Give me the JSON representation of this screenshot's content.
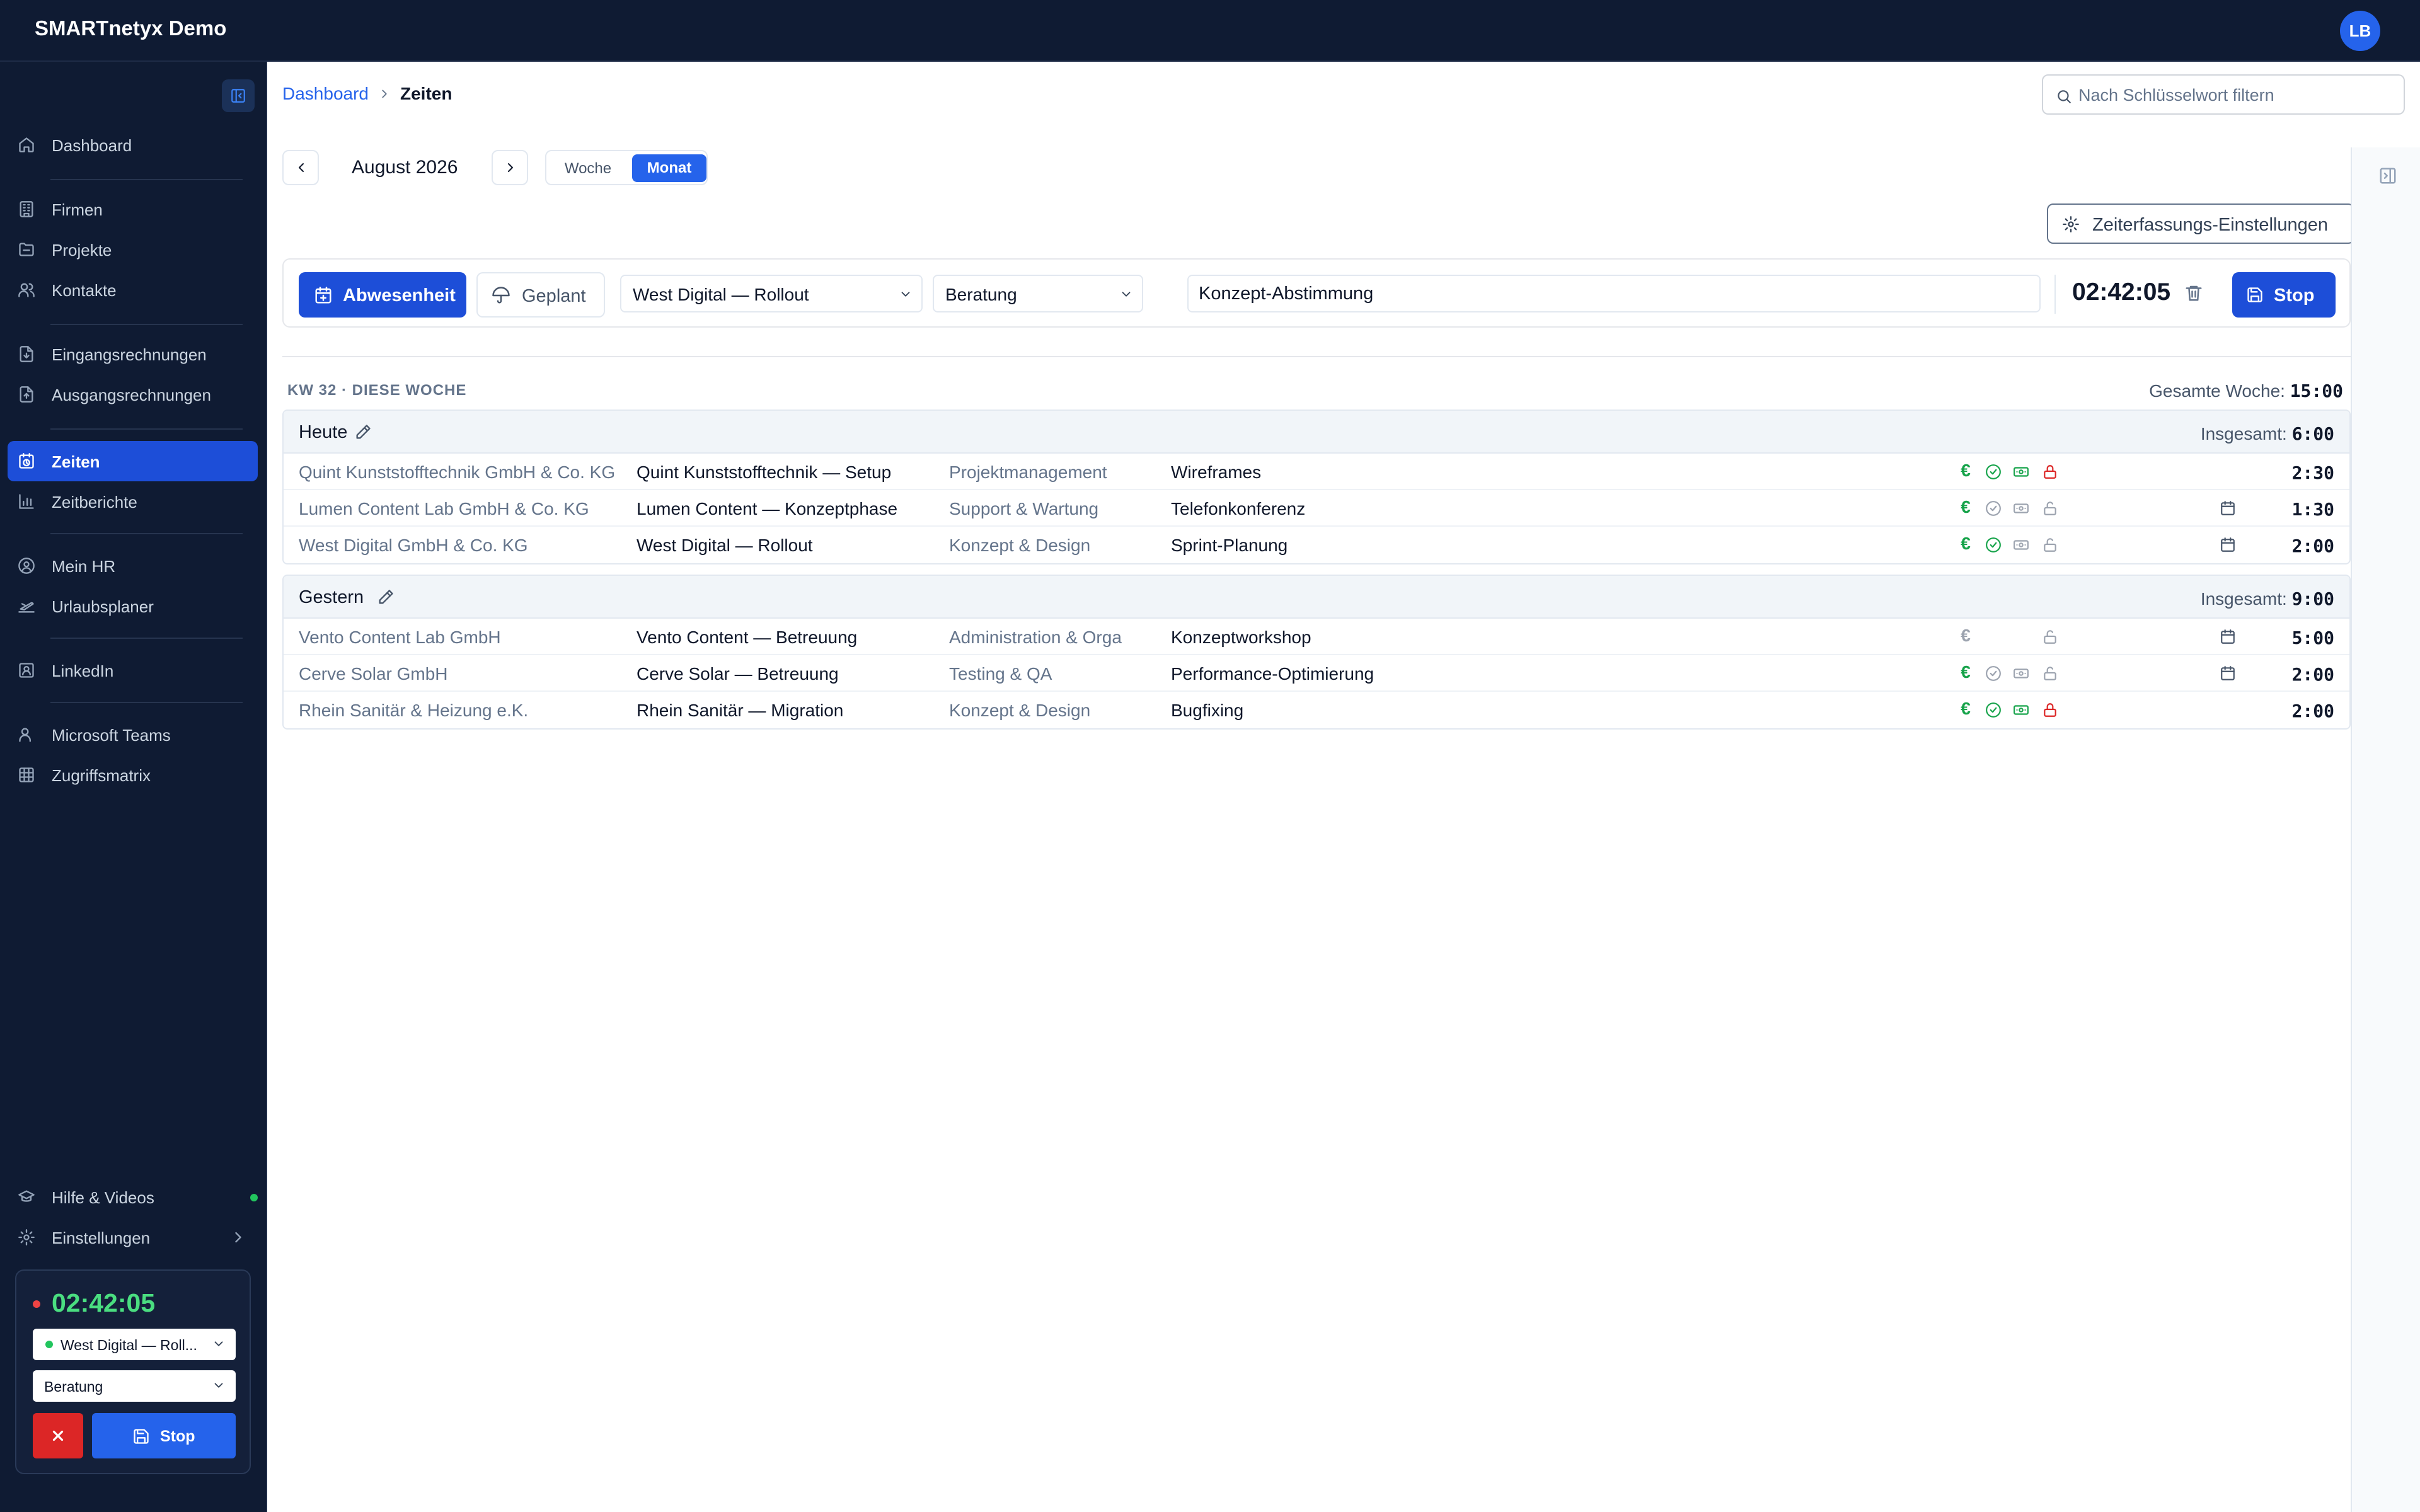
{
  "app": {
    "title": "SMARTnetyx Demo",
    "user_initials": "LB"
  },
  "sidebar": {
    "items": [
      {
        "label": "Dashboard",
        "icon": "home-icon",
        "active": false
      },
      {
        "label": "Firmen",
        "icon": "building-icon",
        "active": false
      },
      {
        "label": "Projekte",
        "icon": "folder-icon",
        "active": false
      },
      {
        "label": "Kontakte",
        "icon": "users-icon",
        "active": false
      },
      {
        "label": "Eingangsrechnungen",
        "icon": "invoice-in-icon",
        "active": false
      },
      {
        "label": "Ausgangsrechnungen",
        "icon": "invoice-out-icon",
        "active": false
      },
      {
        "label": "Zeiten",
        "icon": "clock-icon",
        "active": true
      },
      {
        "label": "Zeitberichte",
        "icon": "chart-icon",
        "active": false
      },
      {
        "label": "Mein HR",
        "icon": "user-circle-icon",
        "active": false
      },
      {
        "label": "Urlaubsplaner",
        "icon": "plane-icon",
        "active": false
      },
      {
        "label": "LinkedIn",
        "icon": "linkedin-icon",
        "active": false
      },
      {
        "label": "Microsoft Teams",
        "icon": "teams-icon",
        "active": false
      },
      {
        "label": "Zugriffsmatrix",
        "icon": "grid-icon",
        "active": false
      }
    ],
    "bottom": {
      "help_label": "Hilfe & Videos",
      "settings_label": "Einstellungen"
    },
    "timer": {
      "time": "02:42:05",
      "project": "West Digital — Roll...",
      "activity": "Beratung",
      "stop_label": "Stop"
    }
  },
  "breadcrumb": {
    "home": "Dashboard",
    "current": "Zeiten"
  },
  "search": {
    "placeholder": "Nach Schlüsselwort filtern"
  },
  "calendar": {
    "period": "August 2026",
    "view_week": "Woche",
    "view_month": "Monat",
    "active_view": "Monat"
  },
  "settings_button": "Zeiterfassungs-Einstellungen",
  "tracker": {
    "absence_label": "Abwesenheit",
    "planned_label": "Geplant",
    "project": "West Digital — Rollout",
    "activity": "Beratung",
    "description": "Konzept-Abstimmung",
    "elapsed": "02:42:05",
    "stop_label": "Stop"
  },
  "week": {
    "label": "KW 32 · DIESE WOCHE",
    "total_label": "Gesamte Woche:",
    "total": "15:00"
  },
  "days": [
    {
      "title": "Heute",
      "total_label": "Insgesamt:",
      "total": "6:00",
      "entries": [
        {
          "company": "Quint Kunststofftechnik GmbH & Co. KG",
          "project": "Quint Kunststofftechnik — Setup",
          "activity": "Projektmanagement",
          "task": "Wireframes",
          "duration": "2:30",
          "billable": true,
          "approved": true,
          "invoiced": true,
          "locked": true,
          "planned": false
        },
        {
          "company": "Lumen Content Lab GmbH & Co. KG",
          "project": "Lumen Content — Konzeptphase",
          "activity": "Support & Wartung",
          "task": "Telefonkonferenz",
          "duration": "1:30",
          "billable": true,
          "approved": false,
          "invoiced": false,
          "locked": false,
          "planned": true
        },
        {
          "company": "West Digital GmbH & Co. KG",
          "project": "West Digital — Rollout",
          "activity": "Konzept & Design",
          "task": "Sprint-Planung",
          "duration": "2:00",
          "billable": true,
          "approved": true,
          "invoiced": false,
          "locked": false,
          "planned": true
        }
      ]
    },
    {
      "title": "Gestern",
      "total_label": "Insgesamt:",
      "total": "9:00",
      "entries": [
        {
          "company": "Vento Content Lab GmbH",
          "project": "Vento Content — Betreuung",
          "activity": "Administration & Orga",
          "task": "Konzeptworkshop",
          "duration": "5:00",
          "billable": false,
          "approved": null,
          "invoiced": null,
          "locked": false,
          "planned": true
        },
        {
          "company": "Cerve Solar GmbH",
          "project": "Cerve Solar — Betreuung",
          "activity": "Testing & QA",
          "task": "Performance-Optimierung",
          "duration": "2:00",
          "billable": true,
          "approved": false,
          "invoiced": false,
          "locked": false,
          "planned": true
        },
        {
          "company": "Rhein Sanitär & Heizung e.K.",
          "project": "Rhein Sanitär — Migration",
          "activity": "Konzept & Design",
          "task": "Bugfixing",
          "duration": "2:00",
          "billable": true,
          "approved": true,
          "invoiced": true,
          "locked": true,
          "planned": false
        }
      ]
    }
  ],
  "colors": {
    "accent": "#2563eb",
    "sidebar_bg": "#0f1b33",
    "success": "#16a34a",
    "danger": "#dc2626",
    "timer_green": "#4ade80"
  }
}
